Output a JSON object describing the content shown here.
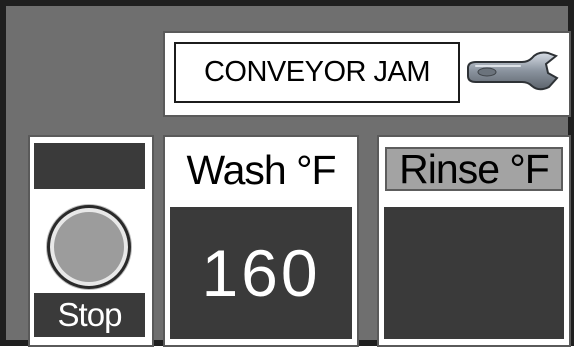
{
  "alarm": {
    "message": "CONVEYOR JAM",
    "icon": "wrench-icon"
  },
  "stop_control": {
    "indicator_state": "off",
    "lamp_state": "off",
    "label": "Stop"
  },
  "wash": {
    "title": "Wash °F",
    "temperature": "160"
  },
  "rinse": {
    "title": "Rinse °F",
    "temperature": ""
  },
  "colors": {
    "background": "#6f6f6f",
    "display_fill": "#3a3a3a",
    "rinse_title_fill": "#a3a3a3",
    "lamp_off": "#9c9c9c"
  }
}
